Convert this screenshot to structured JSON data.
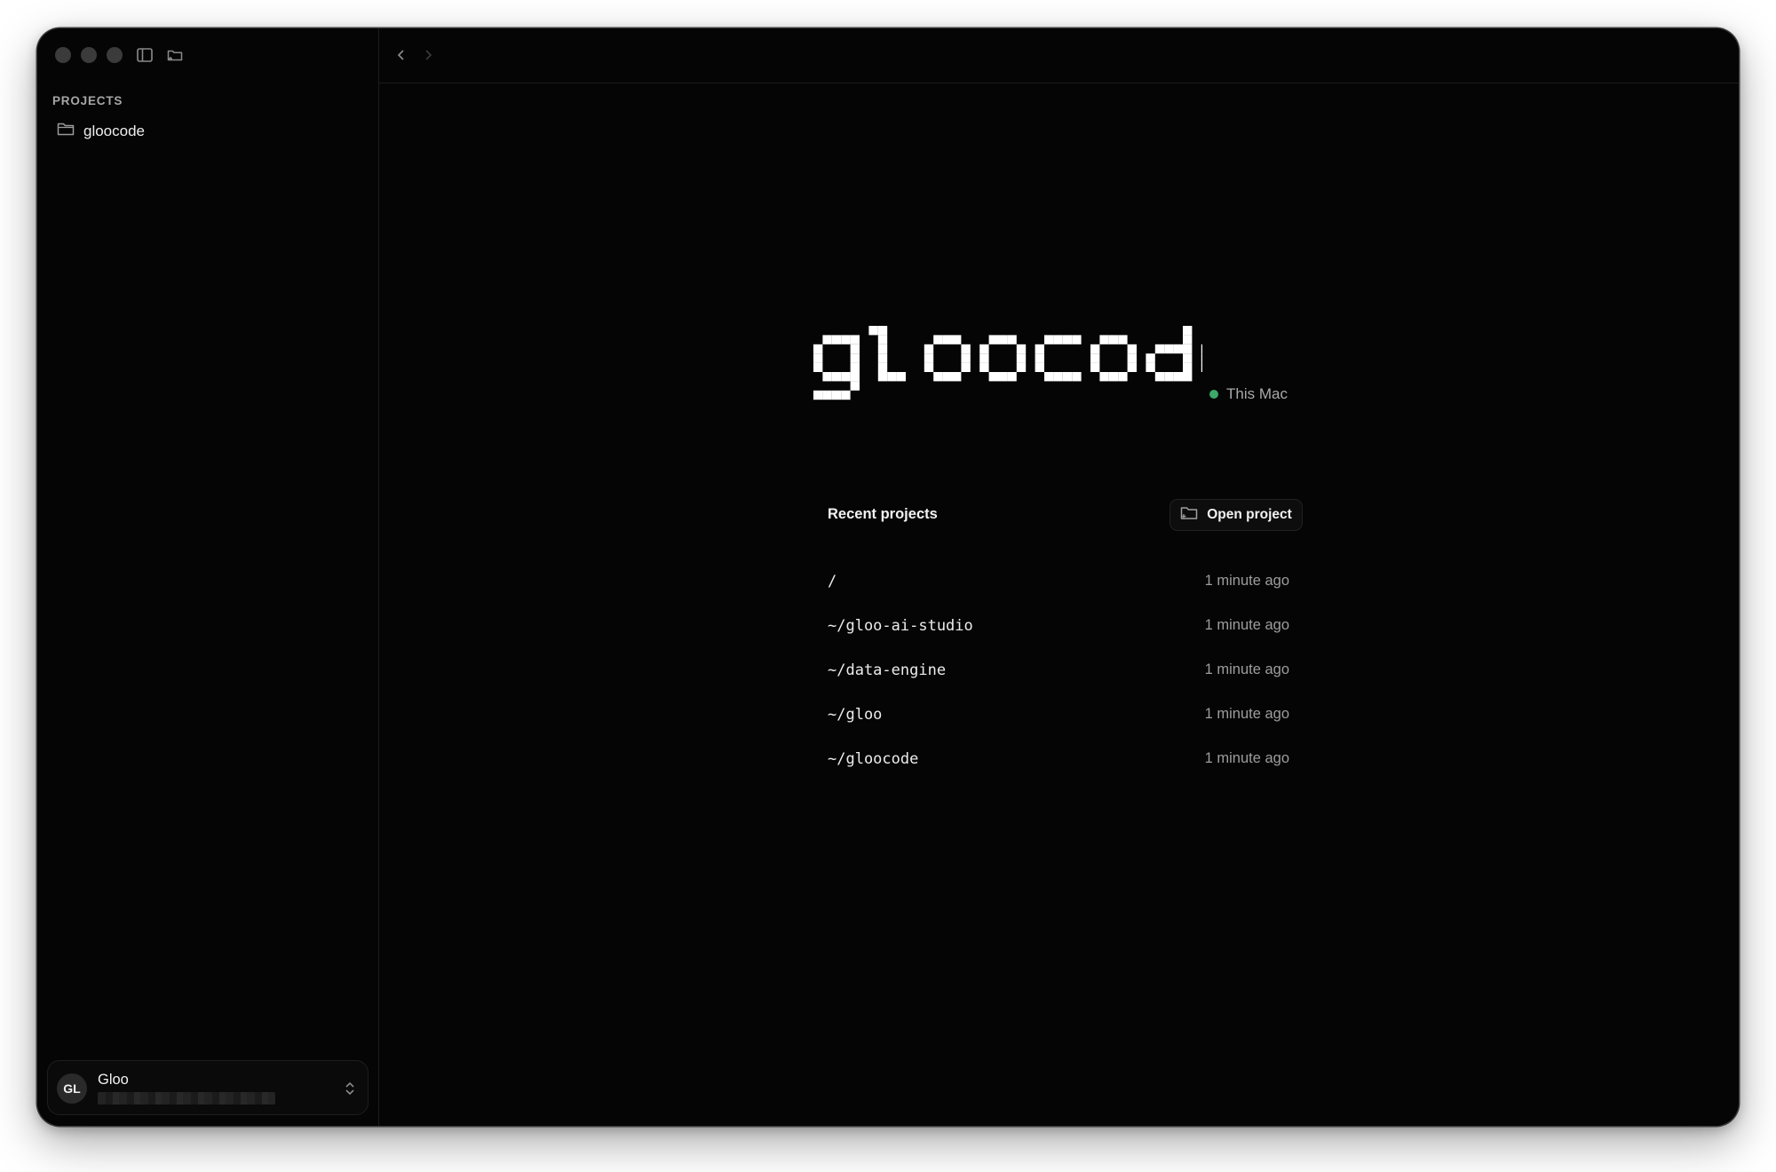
{
  "sidebar": {
    "section_label": "PROJECTS",
    "items": [
      {
        "label": "gloocode",
        "icon": "folder-icon"
      }
    ],
    "account": {
      "initials": "GL",
      "name": "Gloo"
    }
  },
  "main": {
    "logo_text": "gloocode",
    "status": {
      "label": "This Mac",
      "color": "#3ca86a"
    },
    "recent_title": "Recent projects",
    "open_project_label": "Open project",
    "recent_projects": [
      {
        "path": "/",
        "time": "1 minute ago"
      },
      {
        "path": "~/gloo-ai-studio",
        "time": "1 minute ago"
      },
      {
        "path": "~/data-engine",
        "time": "1 minute ago"
      },
      {
        "path": "~/gloo",
        "time": "1 minute ago"
      },
      {
        "path": "~/gloocode",
        "time": "1 minute ago"
      }
    ]
  },
  "colors": {
    "background": "#050505",
    "text": "#f2f2f2",
    "muted": "#9d9d9d",
    "status_green": "#3ca86a"
  }
}
